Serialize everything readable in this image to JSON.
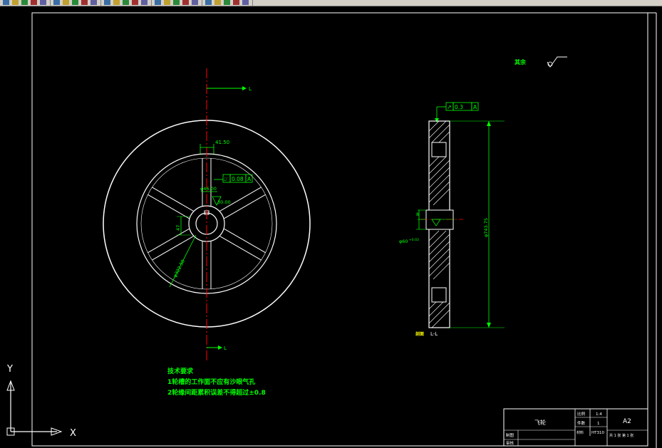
{
  "toolbar": {
    "icons": [
      "new-icon",
      "open-icon",
      "save-icon",
      "print-icon",
      "preview-icon",
      "cut-icon",
      "copy-icon",
      "paste-icon",
      "match-icon",
      "undo-icon",
      "redo-icon",
      "pan-icon",
      "zoom-realtime-icon",
      "zoom-window-icon",
      "zoom-previous-icon",
      "properties-icon",
      "designcenter-icon",
      "toolpalette-icon",
      "sheetset-icon",
      "markup-icon",
      "calc-icon",
      "help-icon",
      "layer-icon",
      "layer-state-icon",
      "layer-prev-icon"
    ]
  },
  "colors": {
    "background": "#000000",
    "geometry": "#ffffff",
    "dimension": "#00ff00",
    "centerline": "#ff0000",
    "note": "#ffff00",
    "symbol": "#00ff00"
  },
  "drawing": {
    "section_arrow_top": "L",
    "section_arrow_bottom": "L",
    "dim_4150": "41.50",
    "dim_4600": "φ46.00",
    "dim_3000": "30.00",
    "dim_4700": "47",
    "dim_radial": "φ322.50",
    "flatness_symbol": "⌰",
    "flatness_value": "0.08",
    "flatness_datum": "A",
    "runout_symbol": "↗",
    "runout_value": "0.3",
    "runout_datum": "A",
    "dia_total": "φ743.75",
    "dia_hub": "φ60",
    "hub_tol": "+0.03",
    "side_dim_small": "8",
    "section_label_prefix": "剖面",
    "section_label": "L-L",
    "surface_label": "其余",
    "notes_title": "技术要求",
    "note_1": "1轮槽的工作面不应有沙眼气孔",
    "note_2": "2轮缘间距累积误差不得超过±0.8"
  },
  "title_block": {
    "part_name": "飞轮",
    "scale_label": "比例",
    "scale_value": "1:4",
    "qty_label": "件数",
    "qty_value": "1",
    "sheet_size": "A2",
    "material": "HT310",
    "sheet_info": "共 1 张  第 1 张",
    "designer_label": "制图",
    "checker_label": "审核",
    "material_label": "材料"
  },
  "ucs": {
    "x_label": "X",
    "y_label": "Y"
  }
}
